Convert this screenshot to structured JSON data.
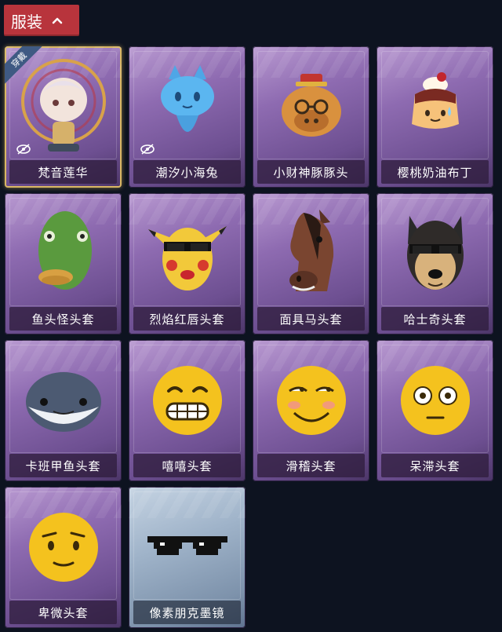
{
  "category": {
    "label": "服装"
  },
  "items": [
    {
      "name": "梵音莲华",
      "icon": "figure-icon",
      "equipped": true,
      "equipped_label": "穿戴",
      "hidden_icon": true
    },
    {
      "name": "潮汐小海兔",
      "icon": "sea-bunny-icon",
      "hidden_icon": true
    },
    {
      "name": "小财神豚豚头",
      "icon": "capybara-head-icon"
    },
    {
      "name": "樱桃奶油布丁",
      "icon": "pudding-icon"
    },
    {
      "name": "鱼头怪头套",
      "icon": "fish-head-icon"
    },
    {
      "name": "烈焰红唇头套",
      "icon": "pikachu-head-icon"
    },
    {
      "name": "面具马头套",
      "icon": "horse-mask-icon"
    },
    {
      "name": "哈士奇头套",
      "icon": "husky-head-icon"
    },
    {
      "name": "卡班甲鱼头套",
      "icon": "fish-head-round-icon"
    },
    {
      "name": "嘻嘻头套",
      "icon": "grin-face-icon"
    },
    {
      "name": "滑稽头套",
      "icon": "sly-face-icon"
    },
    {
      "name": "呆滞头套",
      "icon": "blank-face-icon"
    },
    {
      "name": "卑微头套",
      "icon": "shy-face-icon"
    },
    {
      "name": "像素朋克墨镜",
      "icon": "pixel-sunglasses-icon"
    }
  ]
}
